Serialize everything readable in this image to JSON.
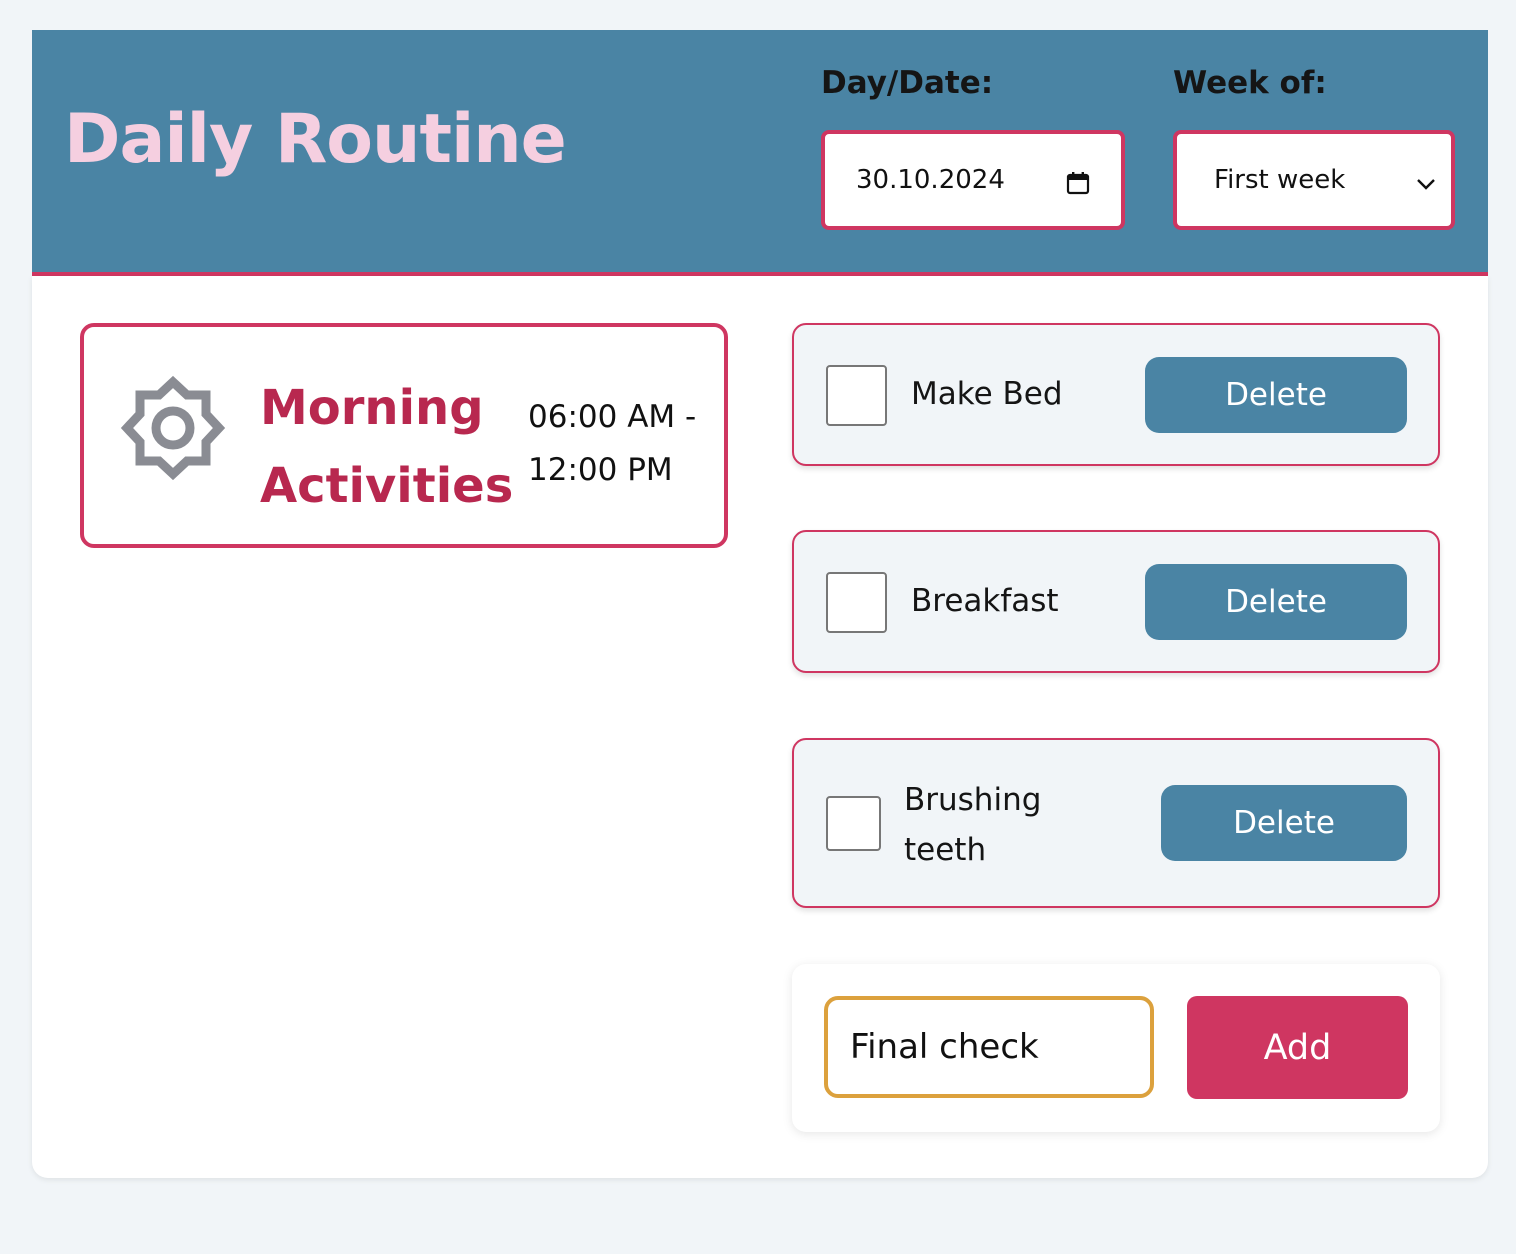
{
  "header": {
    "title": "Daily Routine",
    "day_date_label": "Day/Date:",
    "day_date_value": "30.10.2024",
    "week_label": "Week of:",
    "week_value": "First week"
  },
  "section": {
    "icon": "sun-icon",
    "title": "Morning Activities",
    "time_range": "06:00 AM - 12:00 PM"
  },
  "tasks": [
    {
      "label": "Make Bed",
      "checked": false,
      "delete_label": "Delete"
    },
    {
      "label": "Breakfast",
      "checked": false,
      "delete_label": "Delete"
    },
    {
      "label": "Brushing teeth",
      "checked": false,
      "delete_label": "Delete"
    }
  ],
  "add_task": {
    "input_value": "Final check",
    "button_label": "Add"
  },
  "colors": {
    "header_bg": "#4a84a4",
    "accent": "#cf3661",
    "title_pink": "#f5cfe0",
    "input_border": "#dca13d"
  }
}
